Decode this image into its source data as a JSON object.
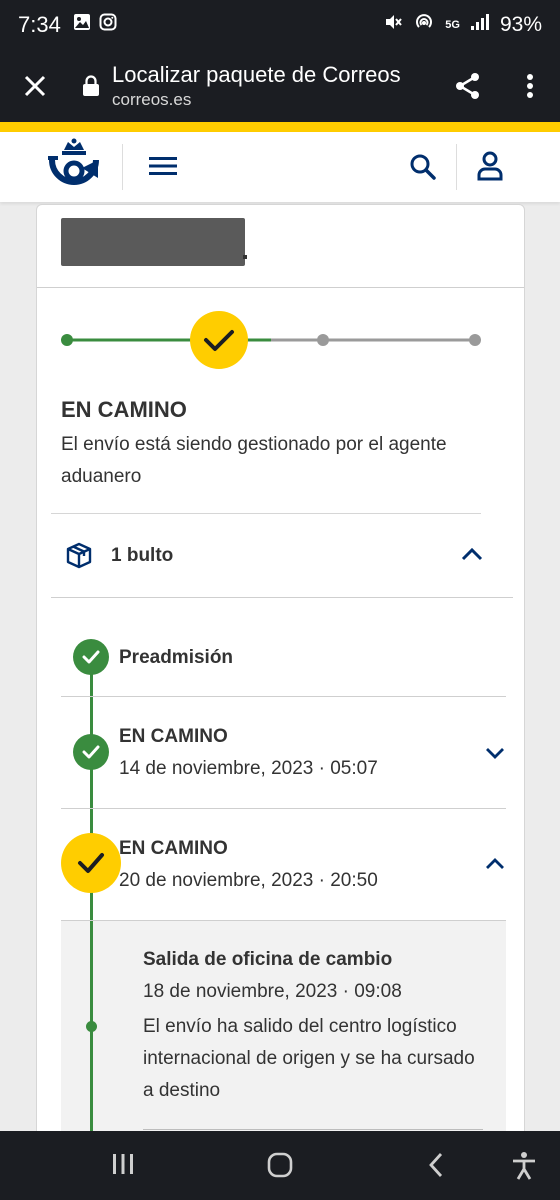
{
  "status_bar": {
    "time": "7:34",
    "network": "5G",
    "battery": "93%"
  },
  "browser": {
    "title": "Localizar paquete de Correos",
    "url": "correos.es"
  },
  "colors": {
    "brand_yellow": "#ffcd00",
    "brand_blue": "#002e6d",
    "success_green": "#3a8c3f",
    "inactive_gray": "#9a9a9a"
  },
  "shipment": {
    "status_title": "EN CAMINO",
    "status_description": "El envío está siendo gestionado por el agente aduanero",
    "progress": {
      "total_steps": 4,
      "current_step": 2
    },
    "packages_label": "1 bulto"
  },
  "events": [
    {
      "title": "Preadmisión",
      "date": "",
      "state": "done"
    },
    {
      "title": "EN CAMINO",
      "date": "14 de noviembre, 2023 · 05:07",
      "state": "done",
      "expanded": false
    },
    {
      "title": "EN CAMINO",
      "date": "20 de noviembre, 2023 · 20:50",
      "state": "current",
      "expanded": true
    }
  ],
  "event_detail": {
    "title": "Salida de oficina de cambio",
    "date": "18 de noviembre, 2023 · 09:08",
    "description": "El envío ha salido del centro logístico internacional de origen y se ha cursado a destino"
  },
  "icons": {
    "status_left": [
      "image-icon",
      "instagram-icon"
    ],
    "status_right": [
      "mute-icon",
      "hotspot-icon",
      "signal-icon"
    ],
    "browser": [
      "close-icon",
      "lock-icon",
      "share-icon",
      "more-icon"
    ],
    "header": [
      "correos-logo",
      "menu-icon",
      "search-icon",
      "user-icon"
    ],
    "nav": [
      "recents-icon",
      "home-icon",
      "back-icon",
      "accessibility-icon"
    ]
  }
}
